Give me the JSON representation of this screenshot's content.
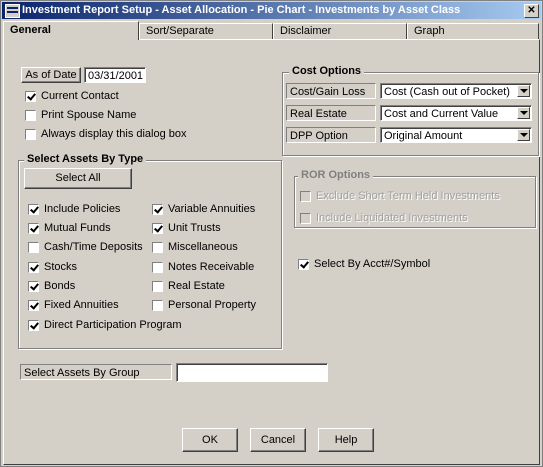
{
  "window": {
    "title": "Investment Report Setup - Asset Allocation - Pie Chart - Investments by Asset Class",
    "close_glyph": "✕"
  },
  "tabs": [
    {
      "label": "General"
    },
    {
      "label": "Sort/Separate"
    },
    {
      "label": "Disclaimer"
    },
    {
      "label": "Graph"
    }
  ],
  "as_of": {
    "button_label": "As of Date",
    "value": "03/31/2001"
  },
  "top_checks": [
    {
      "label": "Current Contact",
      "checked": true
    },
    {
      "label": "Print Spouse Name",
      "checked": false
    },
    {
      "label": "Always display this dialog box",
      "checked": false
    }
  ],
  "assets_group": {
    "title": "Select Assets By Type",
    "select_all_label": "Select All",
    "left": [
      {
        "label": "Include Policies",
        "checked": true
      },
      {
        "label": "Mutual Funds",
        "checked": true
      },
      {
        "label": "Cash/Time Deposits",
        "checked": false
      },
      {
        "label": "Stocks",
        "checked": true
      },
      {
        "label": "Bonds",
        "checked": true
      },
      {
        "label": "Fixed Annuities",
        "checked": true
      },
      {
        "label": "Direct Participation Program",
        "checked": true
      }
    ],
    "right": [
      {
        "label": "Variable Annuities",
        "checked": true
      },
      {
        "label": "Unit Trusts",
        "checked": true
      },
      {
        "label": "Miscellaneous",
        "checked": false
      },
      {
        "label": "Notes Receivable",
        "checked": false
      },
      {
        "label": "Real Estate",
        "checked": false
      },
      {
        "label": "Personal Property",
        "checked": false
      }
    ]
  },
  "cost_options": {
    "title": "Cost Options",
    "rows": [
      {
        "label": "Cost/Gain Loss",
        "value": "Cost (Cash out of Pocket)"
      },
      {
        "label": "Real Estate",
        "value": "Cost and Current Value"
      },
      {
        "label": "DPP Option",
        "value": "Original Amount"
      }
    ]
  },
  "ror_options": {
    "title": "ROR Options",
    "checks": [
      {
        "label": "Exclude Short Term Held Investments",
        "checked": false,
        "disabled": true
      },
      {
        "label": "Include Liquidated Investments",
        "checked": false,
        "disabled": true
      }
    ]
  },
  "select_by_acct": {
    "label": "Select By Acct#/Symbol",
    "checked": true
  },
  "assets_by_group": {
    "label": "Select Assets By Group",
    "value": ""
  },
  "buttons": {
    "ok": "OK",
    "cancel": "Cancel",
    "help": "Help"
  }
}
